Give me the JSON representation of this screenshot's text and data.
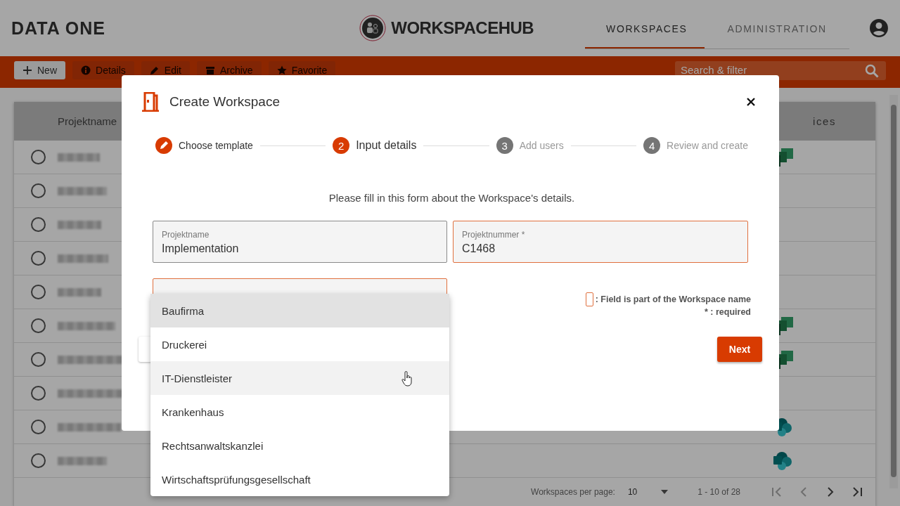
{
  "header": {
    "brand": "DATA ONE",
    "app_logo": "WORKSPACEHUB",
    "tabs": [
      {
        "label": "WORKSPACES",
        "selected": true
      },
      {
        "label": "ADMINISTRATION",
        "selected": false
      }
    ]
  },
  "toolbar": {
    "buttons": [
      {
        "label": "New",
        "kind": "add",
        "disabled": false
      },
      {
        "label": "Details",
        "kind": "info",
        "disabled": true
      },
      {
        "label": "Edit",
        "kind": "edit",
        "disabled": true
      },
      {
        "label": "Archive",
        "kind": "archive",
        "disabled": true
      },
      {
        "label": "Favorite",
        "kind": "star",
        "disabled": true
      }
    ],
    "search": {
      "placeholder": "Search & filter"
    }
  },
  "table": {
    "columns": [
      "Projektname",
      "ices"
    ],
    "rows": [
      {
        "selected": false,
        "kind": "planner"
      },
      {
        "selected": false,
        "kind": "plain"
      },
      {
        "selected": false,
        "kind": "plain"
      },
      {
        "selected": false,
        "kind": "plain"
      },
      {
        "selected": false,
        "kind": "plain"
      },
      {
        "selected": false,
        "kind": "planner"
      },
      {
        "selected": false,
        "kind": "planner"
      },
      {
        "selected": false,
        "kind": "plain"
      },
      {
        "selected": false,
        "kind": "sharepoint"
      },
      {
        "selected": false,
        "kind": "sharepoint"
      }
    ],
    "footer": {
      "per_page_label": "Workspaces per page:",
      "per_page": "10",
      "range": "1 - 10 of 28",
      "nav": [
        {
          "kind": "first",
          "disabled": true
        },
        {
          "kind": "prev",
          "disabled": true
        },
        {
          "kind": "next",
          "disabled": false
        },
        {
          "kind": "last",
          "disabled": false
        }
      ]
    }
  },
  "dialog": {
    "title": "Create Workspace",
    "steps": [
      {
        "label": "Choose template",
        "completed": true,
        "selected": false
      },
      {
        "number": "2",
        "label": "Input details",
        "completed": false,
        "selected": true
      },
      {
        "number": "3",
        "label": "Add users",
        "completed": false,
        "selected": false
      },
      {
        "number": "4",
        "label": "Review and create",
        "completed": false,
        "selected": false
      }
    ],
    "instruction": "Please fill in this form about the Workspace's details.",
    "fields": [
      {
        "label": "Projektname",
        "value": "Implementation",
        "name_part": false
      },
      {
        "label": "Projektnummer *",
        "value": "C1468",
        "name_part": true
      },
      {
        "name_part": true
      }
    ],
    "legend": {
      "name_part": ": Field is part of the Workspace name",
      "required": "* : required"
    },
    "next_button": "Next"
  },
  "menu": {
    "options": [
      {
        "label": "Baufirma",
        "selected": true,
        "hovered": false
      },
      {
        "label": "Druckerei",
        "selected": false,
        "hovered": false
      },
      {
        "label": "IT-Dienstleister",
        "selected": false,
        "hovered": true
      },
      {
        "label": "Krankenhaus",
        "selected": false,
        "hovered": false
      },
      {
        "label": "Rechtsanwaltskanzlei",
        "selected": false,
        "hovered": false
      },
      {
        "label": "Wirtschaftsprüfungsgesellschaft",
        "selected": false,
        "hovered": false
      }
    ]
  }
}
